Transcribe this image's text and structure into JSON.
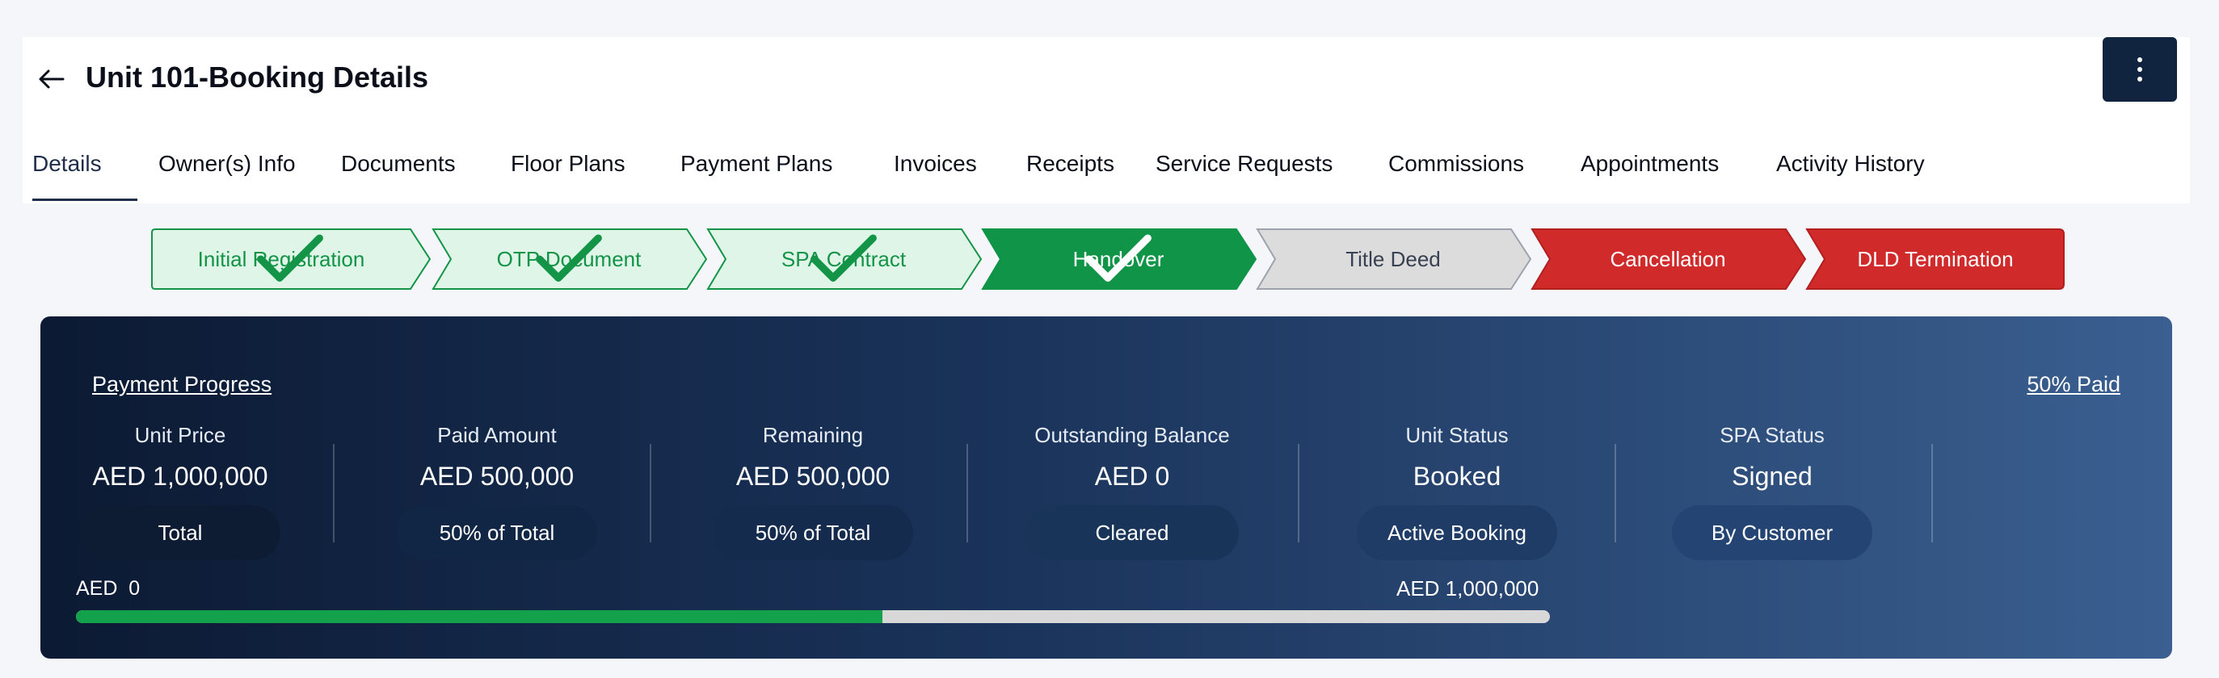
{
  "header": {
    "title": "Unit 101-Booking Details",
    "back_icon": "arrow-left-icon",
    "more_icon": "vertical-dots-icon"
  },
  "tabs": [
    {
      "label": "Details",
      "active": true
    },
    {
      "label": "Owner(s) Info"
    },
    {
      "label": "Documents"
    },
    {
      "label": "Floor Plans"
    },
    {
      "label": "Payment Plans"
    },
    {
      "label": "Invoices"
    },
    {
      "label": "Receipts"
    },
    {
      "label": "Service Requests"
    },
    {
      "label": "Commissions"
    },
    {
      "label": "Appointments"
    },
    {
      "label": "Activity History"
    }
  ],
  "stepper": [
    {
      "label": "Initial Registration",
      "status": "completed"
    },
    {
      "label": "OTP Document",
      "status": "completed"
    },
    {
      "label": "SPA Contract",
      "status": "completed"
    },
    {
      "label": "Handover",
      "status": "current"
    },
    {
      "label": "Title Deed",
      "status": "pending"
    },
    {
      "label": "Cancellation",
      "status": "alert"
    },
    {
      "label": "DLD Termination",
      "status": "alert"
    }
  ],
  "colors": {
    "completed_bg": "#dff5e8",
    "completed_border": "#139447",
    "completed_text": "#139447",
    "current_bg": "#0f9448",
    "pending_bg": "#dcdcdc",
    "pending_border": "#9ca3af",
    "alert_bg": "#d12a2a",
    "progress_fill": "#14a14c",
    "progress_track": "#d8d8d8",
    "navy": "#10233f"
  },
  "payment": {
    "title": "Payment Progress",
    "paid_label": "50% Paid",
    "stats": [
      {
        "label": "Unit Price",
        "value": "AED 1,000,000",
        "pill": "Total"
      },
      {
        "label": "Paid Amount",
        "value": "AED 500,000",
        "pill": "50% of Total"
      },
      {
        "label": "Remaining",
        "value": "AED 500,000",
        "pill": "50% of Total"
      },
      {
        "label": "Outstanding Balance",
        "value": "AED 0",
        "pill": "Cleared"
      },
      {
        "label": "Unit Status",
        "value": "Booked",
        "pill": "Active Booking"
      },
      {
        "label": "SPA Status",
        "value": "Signed",
        "pill": "By Customer"
      }
    ],
    "range_min": "AED  0",
    "range_max": "AED 1,000,000",
    "progress_fraction": 0.547
  }
}
